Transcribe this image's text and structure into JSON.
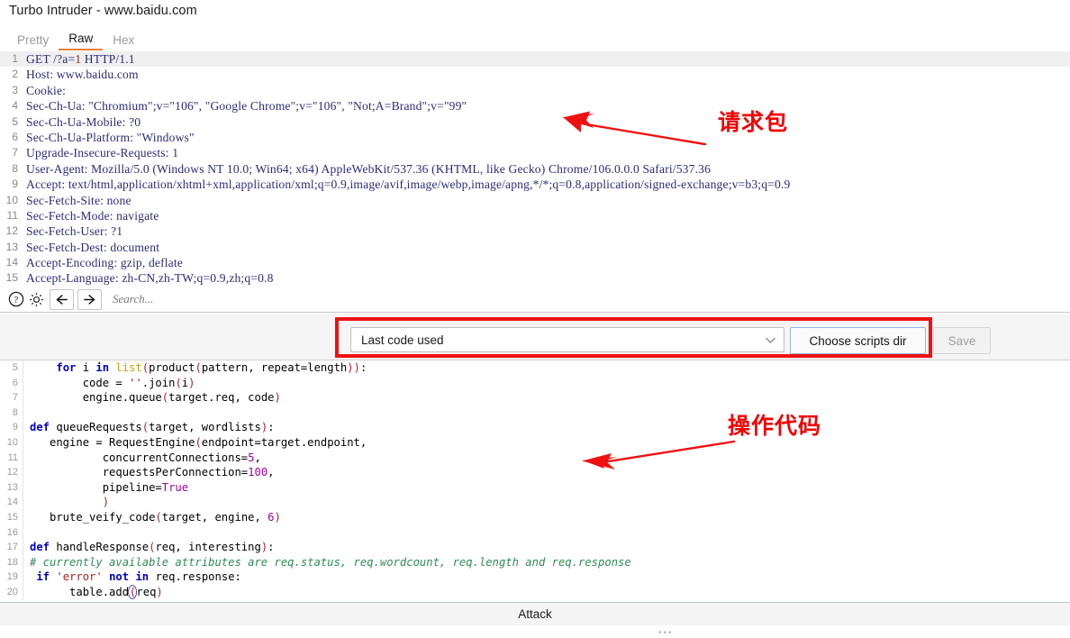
{
  "window": {
    "title": "Turbo Intruder - www.baidu.com"
  },
  "tabs": [
    {
      "label": "Pretty",
      "active": false
    },
    {
      "label": "Raw",
      "active": true
    },
    {
      "label": "Hex",
      "active": false
    }
  ],
  "request": {
    "lines": [
      {
        "n": "1",
        "text": "GET /?a=1 HTTP/1.1"
      },
      {
        "n": "2",
        "text": "Host: www.baidu.com"
      },
      {
        "n": "3",
        "text": "Cookie:"
      },
      {
        "n": "4",
        "text": "Sec-Ch-Ua: \"Chromium\";v=\"106\", \"Google Chrome\";v=\"106\", \"Not;A=Brand\";v=\"99\""
      },
      {
        "n": "5",
        "text": "Sec-Ch-Ua-Mobile: ?0"
      },
      {
        "n": "6",
        "text": "Sec-Ch-Ua-Platform: \"Windows\""
      },
      {
        "n": "7",
        "text": "Upgrade-Insecure-Requests: 1"
      },
      {
        "n": "8",
        "text": "User-Agent: Mozilla/5.0 (Windows NT 10.0; Win64; x64) AppleWebKit/537.36 (KHTML, like Gecko) Chrome/106.0.0.0 Safari/537.36"
      },
      {
        "n": "9",
        "text": "Accept: text/html,application/xhtml+xml,application/xml;q=0.9,image/avif,image/webp,image/apng,*/*;q=0.8,application/signed-exchange;v=b3;q=0.9"
      },
      {
        "n": "10",
        "text": "Sec-Fetch-Site: none"
      },
      {
        "n": "11",
        "text": "Sec-Fetch-Mode: navigate"
      },
      {
        "n": "12",
        "text": "Sec-Fetch-User: ?1"
      },
      {
        "n": "13",
        "text": "Sec-Fetch-Dest: document"
      },
      {
        "n": "14",
        "text": "Accept-Encoding: gzip, deflate"
      },
      {
        "n": "15",
        "text": "Accept-Language: zh-CN,zh-TW;q=0.9,zh;q=0.8"
      }
    ]
  },
  "toolbar": {
    "help_icon": "question-circle-icon",
    "settings_icon": "gear-icon",
    "back_icon": "arrow-left-icon",
    "forward_icon": "arrow-right-icon",
    "search_placeholder": "Search...",
    "search_value": ""
  },
  "script_bar": {
    "selected_script": "Last code used",
    "dropdown_icon": "chevron-down-icon",
    "choose_dir_label": "Choose scripts dir",
    "save_label": "Save",
    "save_enabled": false,
    "splitter_dots": "•••"
  },
  "code": {
    "lines": [
      {
        "n": "5",
        "segments": [
          {
            "t": "    ",
            "c": ""
          },
          {
            "t": "for",
            "c": "k"
          },
          {
            "t": " i ",
            "c": ""
          },
          {
            "t": "in",
            "c": "k"
          },
          {
            "t": " ",
            "c": ""
          },
          {
            "t": "list",
            "c": "b"
          },
          {
            "t": "(",
            "c": "p"
          },
          {
            "t": "product",
            "c": ""
          },
          {
            "t": "(",
            "c": "p"
          },
          {
            "t": "pattern, repeat=length",
            "c": ""
          },
          {
            "t": "))",
            "c": "p"
          },
          {
            "t": ":",
            "c": ""
          }
        ]
      },
      {
        "n": "6",
        "segments": [
          {
            "t": "        code = ",
            "c": ""
          },
          {
            "t": "''",
            "c": "s"
          },
          {
            "t": ".join",
            "c": ""
          },
          {
            "t": "(",
            "c": "p"
          },
          {
            "t": "i",
            "c": ""
          },
          {
            "t": ")",
            "c": "p"
          }
        ]
      },
      {
        "n": "7",
        "segments": [
          {
            "t": "        engine.queue",
            "c": ""
          },
          {
            "t": "(",
            "c": "p"
          },
          {
            "t": "target.req, code",
            "c": ""
          },
          {
            "t": ")",
            "c": "p"
          }
        ]
      },
      {
        "n": "8",
        "segments": [
          {
            "t": "",
            "c": ""
          }
        ]
      },
      {
        "n": "9",
        "segments": [
          {
            "t": "def",
            "c": "k"
          },
          {
            "t": " queueRequests",
            "c": ""
          },
          {
            "t": "(",
            "c": "p"
          },
          {
            "t": "target, wordlists",
            "c": ""
          },
          {
            "t": ")",
            "c": "p"
          },
          {
            "t": ":",
            "c": ""
          }
        ]
      },
      {
        "n": "10",
        "segments": [
          {
            "t": "   engine = RequestEngine",
            "c": ""
          },
          {
            "t": "(",
            "c": "p"
          },
          {
            "t": "endpoint=target.endpoint,",
            "c": ""
          }
        ]
      },
      {
        "n": "11",
        "segments": [
          {
            "t": "           concurrentConnections=",
            "c": ""
          },
          {
            "t": "5",
            "c": "n"
          },
          {
            "t": ",",
            "c": ""
          }
        ]
      },
      {
        "n": "12",
        "segments": [
          {
            "t": "           requestsPerConnection=",
            "c": ""
          },
          {
            "t": "100",
            "c": "n"
          },
          {
            "t": ",",
            "c": ""
          }
        ]
      },
      {
        "n": "13",
        "segments": [
          {
            "t": "           pipeline=",
            "c": ""
          },
          {
            "t": "True",
            "c": "n"
          }
        ]
      },
      {
        "n": "14",
        "segments": [
          {
            "t": "           ",
            "c": ""
          },
          {
            "t": ")",
            "c": "p"
          }
        ]
      },
      {
        "n": "15",
        "segments": [
          {
            "t": "   brute_veify_code",
            "c": ""
          },
          {
            "t": "(",
            "c": "p"
          },
          {
            "t": "target, engine, ",
            "c": ""
          },
          {
            "t": "6",
            "c": "n"
          },
          {
            "t": ")",
            "c": "p"
          }
        ]
      },
      {
        "n": "16",
        "segments": [
          {
            "t": "",
            "c": ""
          }
        ]
      },
      {
        "n": "17",
        "segments": [
          {
            "t": "def",
            "c": "k"
          },
          {
            "t": " handleResponse",
            "c": ""
          },
          {
            "t": "(",
            "c": "p"
          },
          {
            "t": "req, interesting",
            "c": ""
          },
          {
            "t": ")",
            "c": "p"
          },
          {
            "t": ":",
            "c": ""
          }
        ]
      },
      {
        "n": "18",
        "segments": [
          {
            "t": "# currently available attributes are req.status, req.wordcount, req.length and req.response",
            "c": "c"
          }
        ]
      },
      {
        "n": "19",
        "segments": [
          {
            "t": " ",
            "c": ""
          },
          {
            "t": "if",
            "c": "k"
          },
          {
            "t": " ",
            "c": ""
          },
          {
            "t": "'error'",
            "c": "s"
          },
          {
            "t": " ",
            "c": ""
          },
          {
            "t": "not",
            "c": "k"
          },
          {
            "t": " ",
            "c": ""
          },
          {
            "t": "in",
            "c": "k"
          },
          {
            "t": " req.response:",
            "c": ""
          }
        ]
      },
      {
        "n": "20",
        "segments": [
          {
            "t": "      table.add",
            "c": ""
          },
          {
            "t": "(",
            "c": "cursor-paren"
          },
          {
            "t": "req",
            "c": ""
          },
          {
            "t": ")",
            "c": "p"
          }
        ]
      }
    ]
  },
  "attack": {
    "label": "Attack"
  },
  "annotations": [
    {
      "text": "请求包",
      "color": "#f00000"
    },
    {
      "text": "操作代码",
      "color": "#f00000"
    }
  ]
}
